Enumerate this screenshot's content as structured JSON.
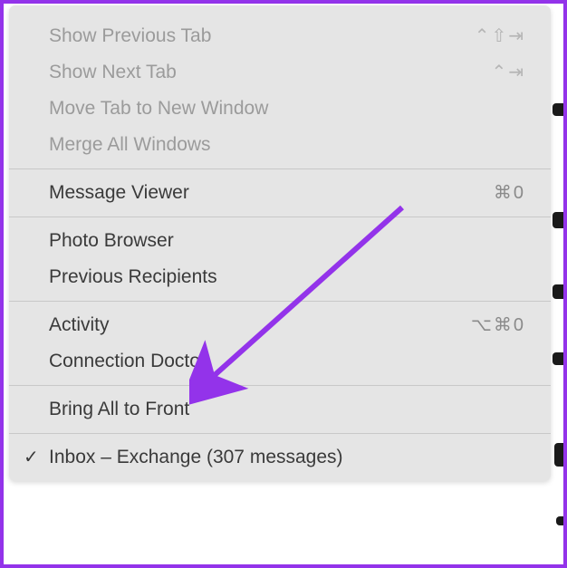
{
  "menu": {
    "group1": [
      {
        "label": "Show Previous Tab",
        "shortcut": "⌃⇧⇥",
        "disabled": true
      },
      {
        "label": "Show Next Tab",
        "shortcut": "⌃⇥",
        "disabled": true
      },
      {
        "label": "Move Tab to New Window",
        "shortcut": "",
        "disabled": true
      },
      {
        "label": "Merge All Windows",
        "shortcut": "",
        "disabled": true
      }
    ],
    "group2": [
      {
        "label": "Message Viewer",
        "shortcut": "⌘0"
      }
    ],
    "group3": [
      {
        "label": "Photo Browser",
        "shortcut": ""
      },
      {
        "label": "Previous Recipients",
        "shortcut": ""
      }
    ],
    "group4": [
      {
        "label": "Activity",
        "shortcut": "⌥⌘0"
      },
      {
        "label": "Connection Doctor",
        "shortcut": ""
      }
    ],
    "group5": [
      {
        "label": "Bring All to Front",
        "shortcut": ""
      }
    ],
    "group6": [
      {
        "label": "Inbox – Exchange (307 messages)",
        "shortcut": "",
        "checked": true
      }
    ]
  },
  "annotation": {
    "arrow_color": "#9333ea"
  }
}
